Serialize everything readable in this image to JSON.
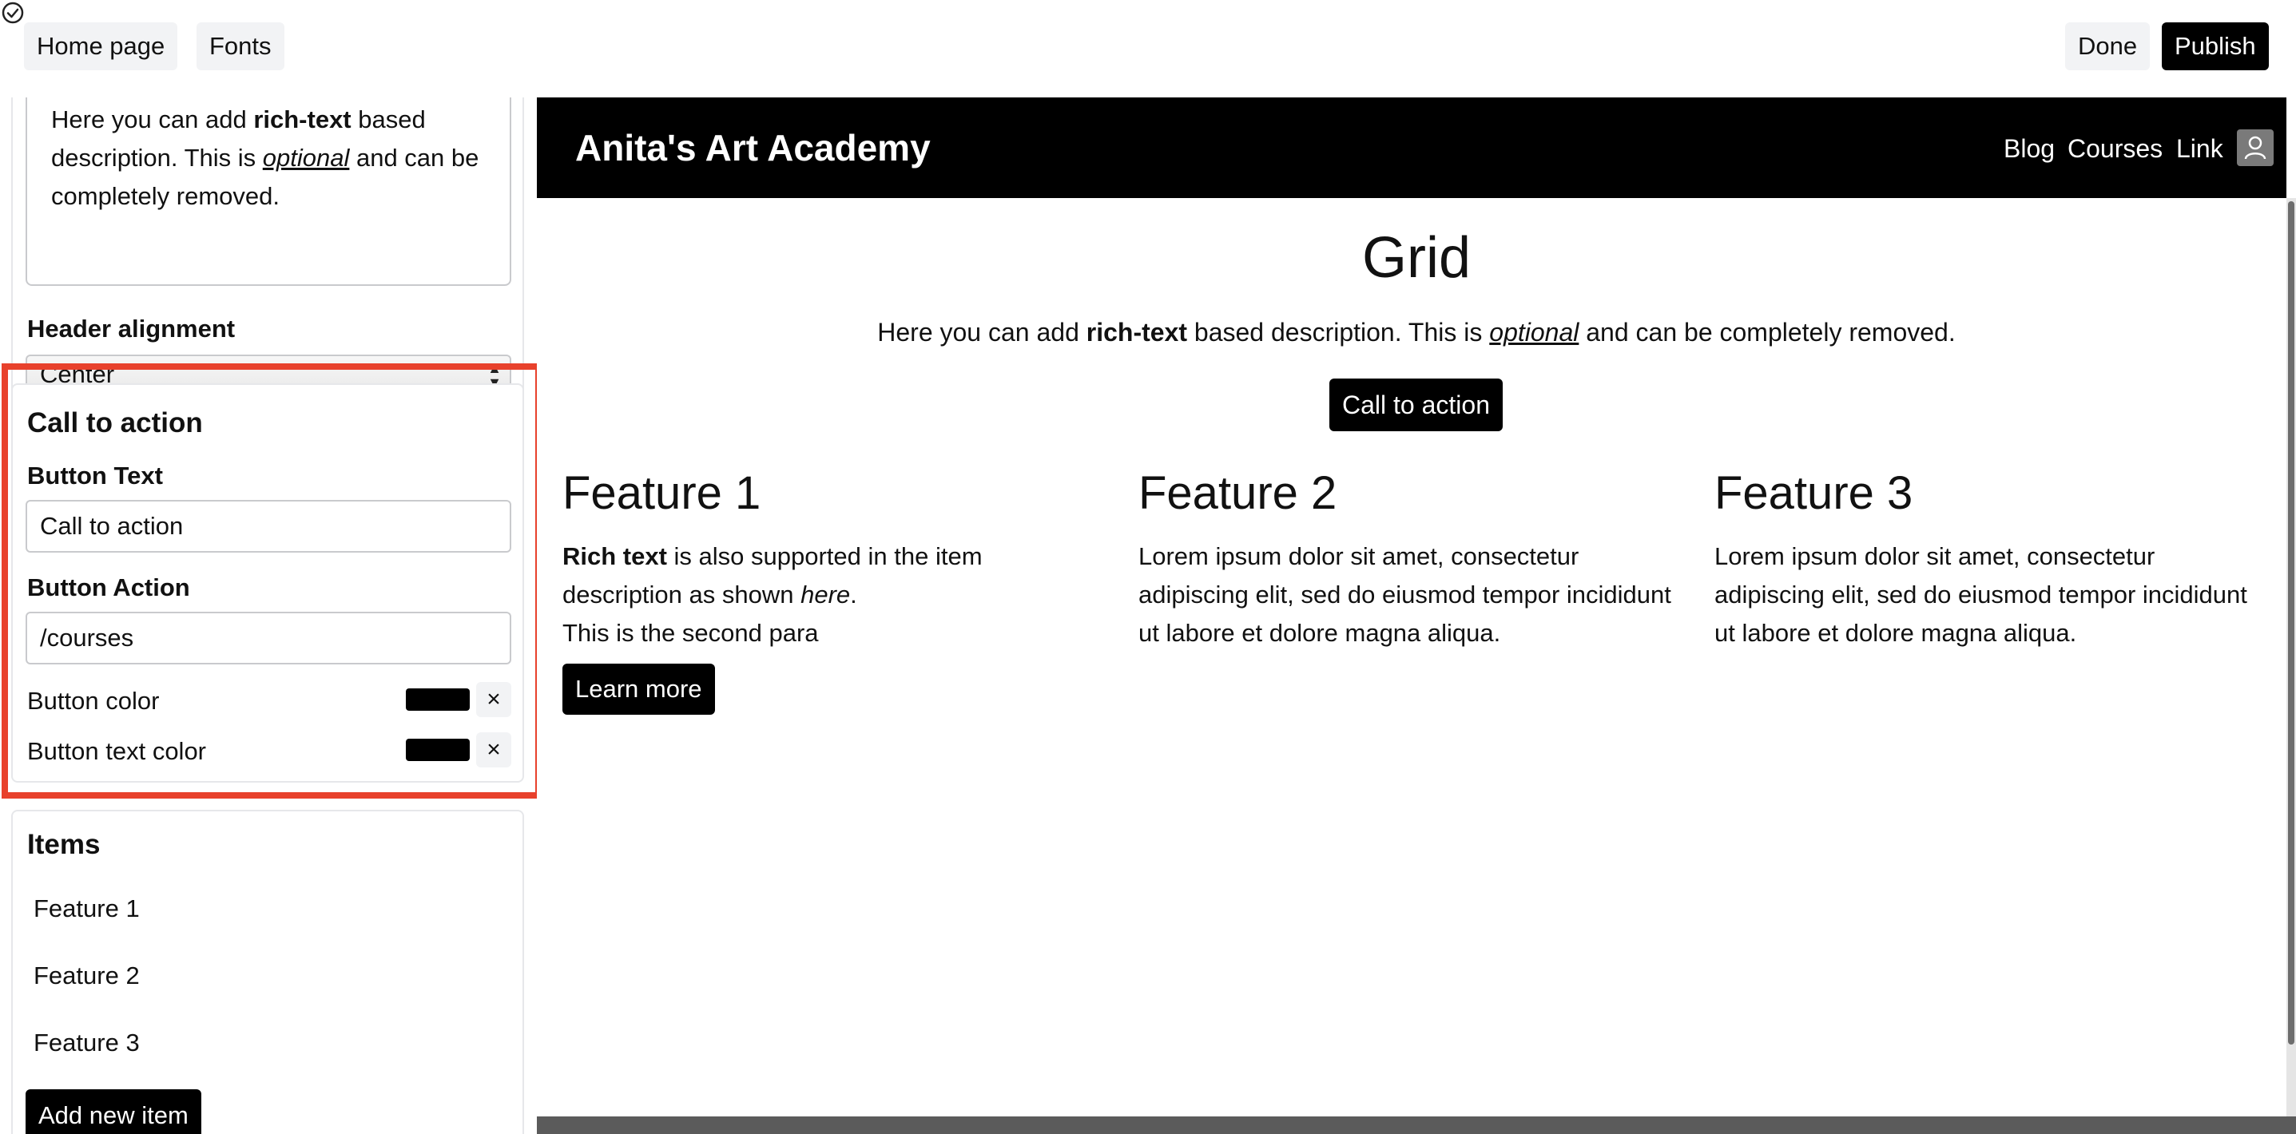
{
  "topbar": {
    "home_label": "Home page",
    "fonts_label": "Fonts",
    "done_label": "Done",
    "publish_label": "Publish"
  },
  "sidebar": {
    "header_panel": {
      "desc_text_1": "Here you can add ",
      "desc_bold": "rich-text",
      "desc_text_2": " based description. This is ",
      "desc_em": "optional",
      "desc_text_3": " and can be completely removed.",
      "alignment_label": "Header alignment",
      "alignment_value": "Center"
    },
    "cta_panel": {
      "title": "Call to action",
      "button_text_label": "Button Text",
      "button_text_value": "Call to action",
      "button_action_label": "Button Action",
      "button_action_value": "/courses",
      "button_color_label": "Button color",
      "button_color_value": "#000000",
      "button_text_color_label": "Button text color",
      "button_text_color_value": "#000000",
      "clear_glyph": "×"
    },
    "items_panel": {
      "title": "Items",
      "items": [
        {
          "label": "Feature 1"
        },
        {
          "label": "Feature 2"
        },
        {
          "label": "Feature 3"
        }
      ],
      "add_label": "Add new item"
    }
  },
  "preview": {
    "brand": "Anita's Art Academy",
    "nav": {
      "blog": "Blog",
      "courses": "Courses",
      "link": "Link"
    },
    "grid_title": "Grid",
    "desc_text_1": "Here you can add ",
    "desc_bold": "rich-text",
    "desc_text_2": " based description. This is ",
    "desc_em": "optional",
    "desc_text_3": " and can be completely removed.",
    "cta_label": "Call to action",
    "features": [
      {
        "title": "Feature 1",
        "bold": "Rich text",
        "text_1": " is also supported in the item description as shown ",
        "em": "here",
        "text_2": ".",
        "para_2": "This is the second para",
        "learn_more": "Learn more"
      },
      {
        "title": "Feature 2",
        "text": "Lorem ipsum dolor sit amet, consectetur adipiscing elit, sed do eiusmod tempor incididunt ut labore et dolore magna aliqua."
      },
      {
        "title": "Feature 3",
        "text": "Lorem ipsum dolor sit amet, consectetur adipiscing elit, sed do eiusmod tempor incididunt ut labore et dolore magna aliqua."
      }
    ]
  },
  "colors": {
    "highlight": "#e8412c",
    "accent_black": "#000000"
  },
  "icons": {
    "check": "check-circle-icon",
    "avatar": "user-icon",
    "select_arrows": "updown-icon",
    "arrow": "left-arrow-icon"
  }
}
